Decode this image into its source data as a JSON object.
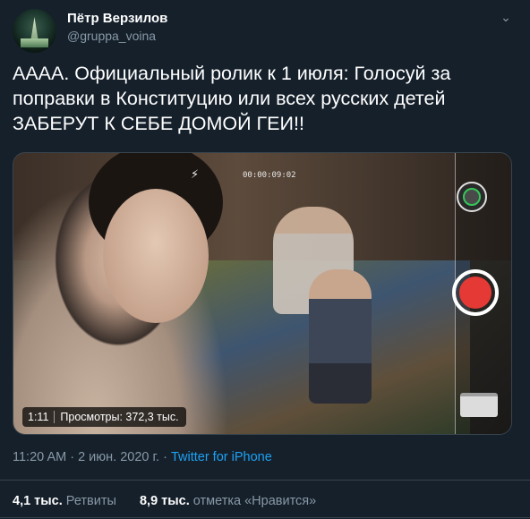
{
  "author": {
    "name": "Пётр Верзилов",
    "handle": "@gruppa_voina",
    "avatar_icon": "tower-icon"
  },
  "tweet": {
    "text": "АААА. Официальный ролик к 1 июля: Голосуй за поправки в Конституцию или всех русских детей ЗАБЕРУТ К СЕБЕ ДОМОЙ ГЕИ!!"
  },
  "video": {
    "duration": "1:11",
    "views": "Просмотры: 372,3 тыс.",
    "recording_timer": "00:00:09:02",
    "flash_icon": "flash-off-icon",
    "record_color": "#e53935"
  },
  "meta": {
    "time": "11:20 AM",
    "sep1": " · ",
    "date": "2 июн. 2020 г.",
    "sep2": " · ",
    "source": "Twitter for iPhone"
  },
  "stats": {
    "retweets_count": "4,1 тыс.",
    "retweets_label": "Ретвиты",
    "likes_count": "8,9 тыс.",
    "likes_label": "отметка «Нравится»"
  },
  "colors": {
    "background": "#15202b",
    "secondary_text": "#8899a6",
    "link": "#1da1f2",
    "divider": "#38444d"
  }
}
